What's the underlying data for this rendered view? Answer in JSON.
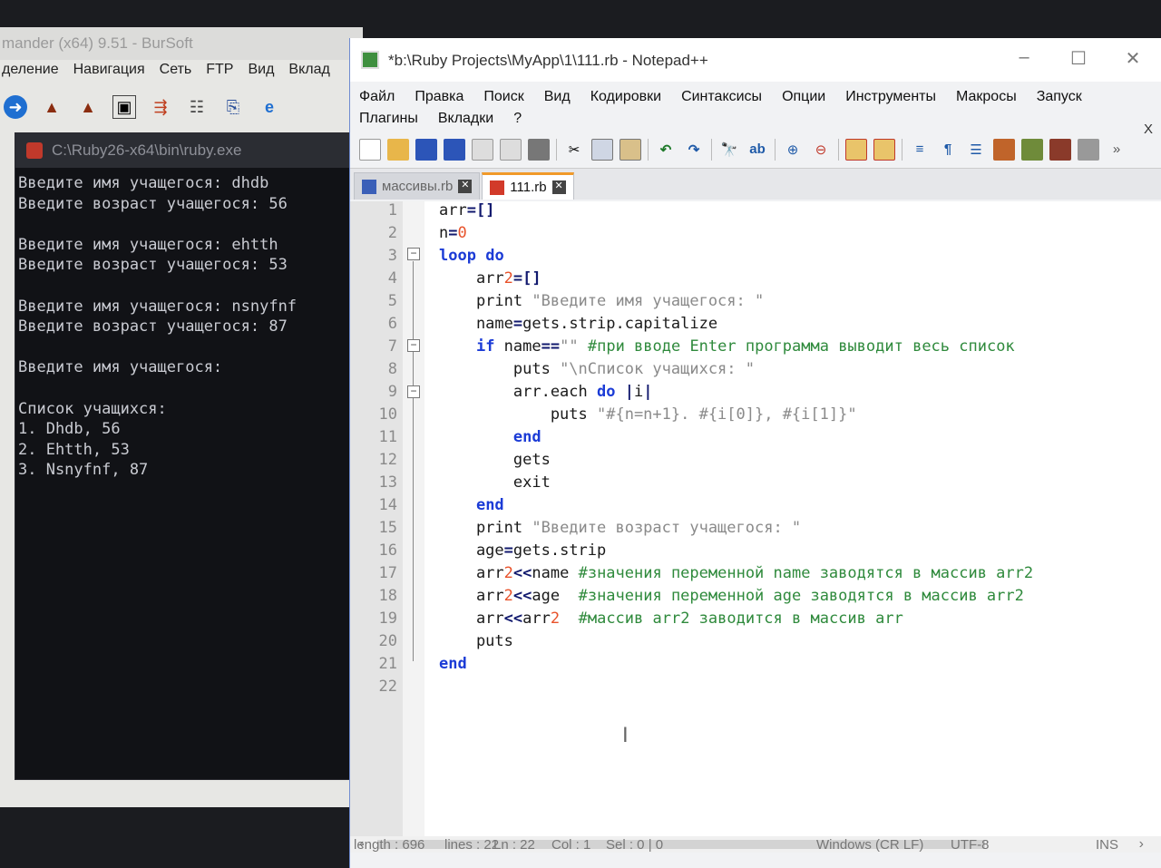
{
  "total_commander": {
    "title": "mander (x64) 9.51 - BurSoft",
    "menu": [
      "деление",
      "Навигация",
      "Сеть",
      "FTP",
      "Вид",
      "Вклад"
    ]
  },
  "console": {
    "title": "C:\\Ruby26-x64\\bin\\ruby.exe",
    "lines": [
      "Введите имя учащегося: dhdb",
      "Введите возраст учащегося: 56",
      "",
      "Введите имя учащегося: ehtth",
      "Введите возраст учащегося: 53",
      "",
      "Введите имя учащегося: nsnyfnf",
      "Введите возраст учащегося: 87",
      "",
      "Введите имя учащегося:",
      "",
      "Список учащихся:",
      "1. Dhdb, 56",
      "2. Ehtth, 53",
      "3. Nsnyfnf, 87"
    ]
  },
  "notepad": {
    "title": "*b:\\Ruby Projects\\MyApp\\1\\111.rb - Notepad++",
    "menu_row1": [
      "Файл",
      "Правка",
      "Поиск",
      "Вид",
      "Кодировки",
      "Синтаксисы",
      "Опции",
      "Инструменты",
      "Макросы",
      "Запуск"
    ],
    "menu_row2": [
      "Плагины",
      "Вкладки",
      "?"
    ],
    "close_doc": "X",
    "tabs": [
      {
        "label": "массивы.rb",
        "active": false
      },
      {
        "label": "111.rb",
        "active": true
      }
    ],
    "line_numbers": [
      "1",
      "2",
      "3",
      "4",
      "5",
      "6",
      "7",
      "8",
      "9",
      "10",
      "11",
      "12",
      "13",
      "14",
      "15",
      "16",
      "17",
      "18",
      "19",
      "20",
      "21",
      "22"
    ],
    "code": [
      "arr=[]",
      "n=0",
      "loop do",
      "    arr2=[]",
      "    print \"Введите имя учащегося: \"",
      "    name=gets.strip.capitalize",
      "    if name==\"\" #при вводе Enter программа выводит весь список",
      "        puts \"\\nСписок учащихся: \"",
      "        arr.each do |i|",
      "            puts \"#{n=n+1}. #{i[0]}, #{i[1]}\"",
      "        end",
      "        gets",
      "        exit",
      "    end",
      "    print \"Введите возраст учащегося: \"",
      "    age=gets.strip",
      "    arr2<<name #значения переменной name заводятся в массив arr2",
      "    arr2<<age  #значения переменной age заводятся в массив arr2",
      "    arr<<arr2  #массив arr2 заводится в массив arr",
      "    puts",
      "end",
      ""
    ],
    "status": {
      "length": "length : 696",
      "lines": "lines : 22",
      "ln": "Ln : 22",
      "col": "Col : 1",
      "sel": "Sel : 0 | 0",
      "eol": "Windows (CR LF)",
      "encoding": "UTF-8",
      "mode": "INS"
    }
  }
}
